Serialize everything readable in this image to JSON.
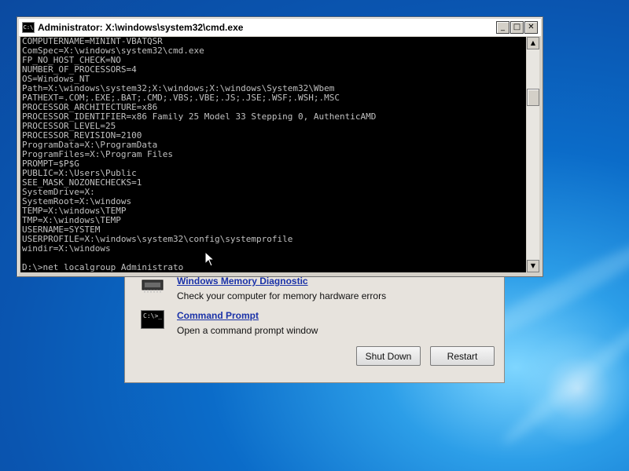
{
  "cmd_window": {
    "title": "Administrator: X:\\windows\\system32\\cmd.exe",
    "icon_label": "C:\\",
    "minimize": "_",
    "maximize": "□",
    "close": "✕",
    "console_lines": [
      "COMPUTERNAME=MININT-VBATQSR",
      "ComSpec=X:\\windows\\system32\\cmd.exe",
      "FP_NO_HOST_CHECK=NO",
      "NUMBER_OF_PROCESSORS=4",
      "OS=Windows_NT",
      "Path=X:\\windows\\system32;X:\\windows;X:\\windows\\System32\\Wbem",
      "PATHEXT=.COM;.EXE;.BAT;.CMD;.VBS;.VBE;.JS;.JSE;.WSF;.WSH;.MSC",
      "PROCESSOR_ARCHITECTURE=x86",
      "PROCESSOR_IDENTIFIER=x86 Family 25 Model 33 Stepping 0, AuthenticAMD",
      "PROCESSOR_LEVEL=25",
      "PROCESSOR_REVISION=2100",
      "ProgramData=X:\\ProgramData",
      "ProgramFiles=X:\\Program Files",
      "PROMPT=$P$G",
      "PUBLIC=X:\\Users\\Public",
      "SEE_MASK_NOZONECHECKS=1",
      "SystemDrive=X:",
      "SystemRoot=X:\\windows",
      "TEMP=X:\\windows\\TEMP",
      "TMP=X:\\windows\\TEMP",
      "USERNAME=SYSTEM",
      "USERPROFILE=X:\\windows\\system32\\config\\systemprofile",
      "windir=X:\\windows"
    ],
    "prompt_input": "D:\\>net localgroup Administrato"
  },
  "recovery_dialog": {
    "memory_title": "Windows Memory Diagnostic",
    "memory_desc": "Check your computer for memory hardware errors",
    "cmd_title": "Command Prompt",
    "cmd_desc": "Open a command prompt window",
    "cmd_icon_label": "C:\\>_",
    "shutdown_label": "Shut Down",
    "restart_label": "Restart"
  }
}
